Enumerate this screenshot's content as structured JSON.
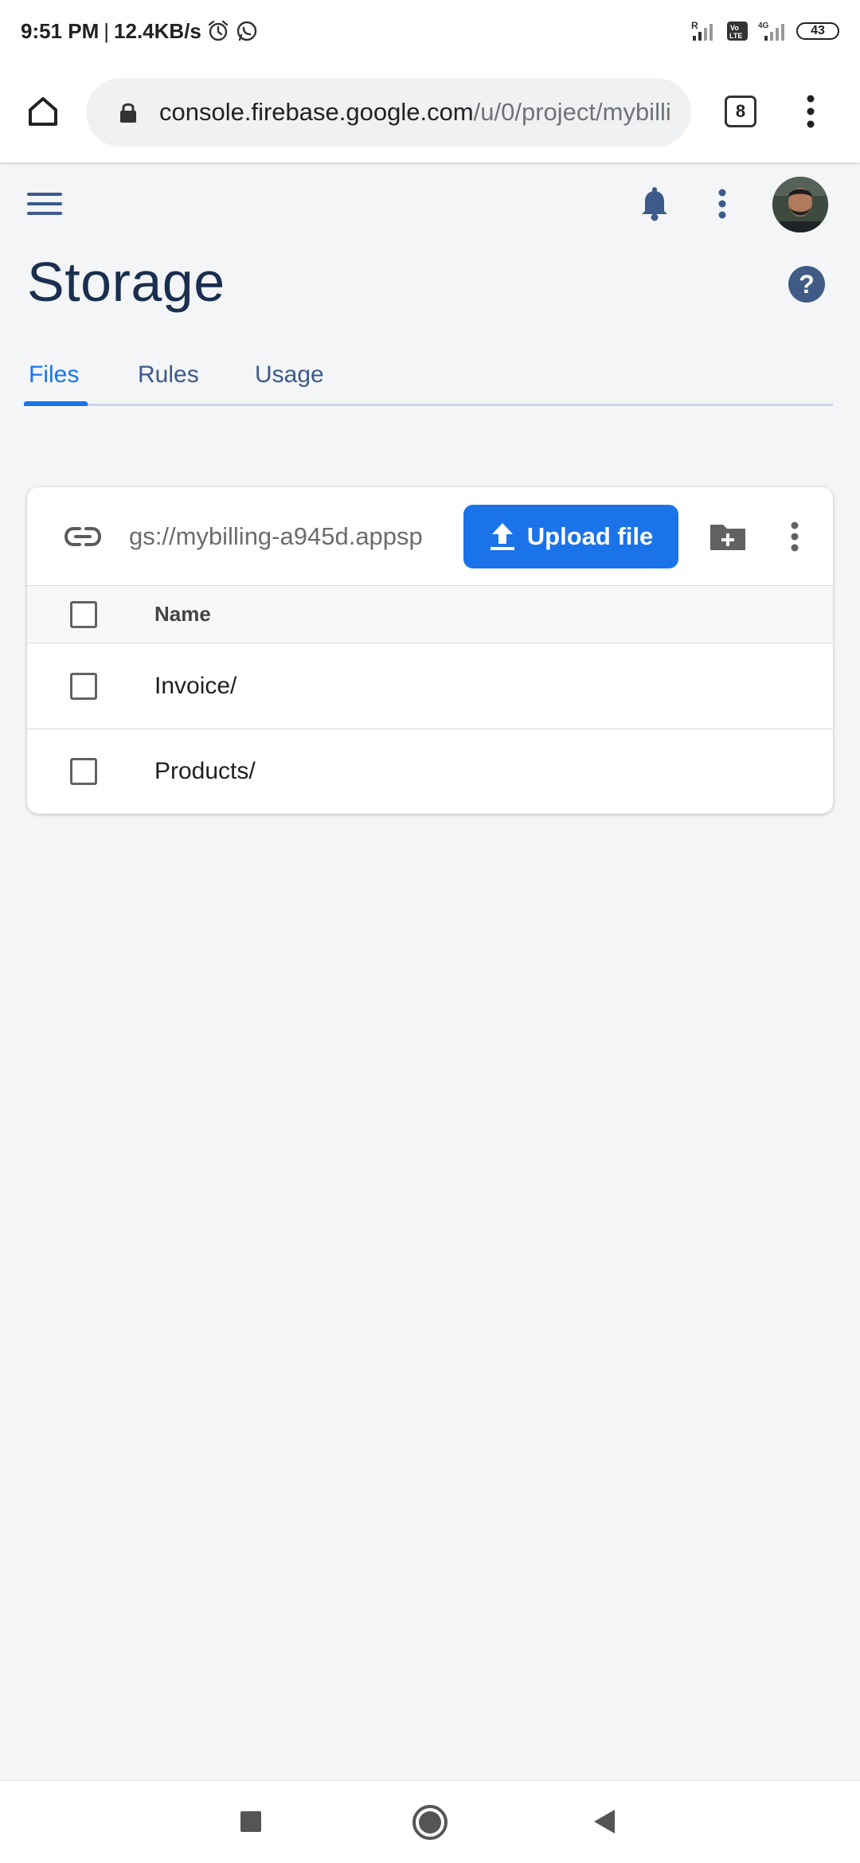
{
  "status_bar": {
    "time": "9:51 PM",
    "separator": "|",
    "speed": "12.4KB/s",
    "battery": "43",
    "icons": [
      "alarm-icon",
      "whatsapp-icon",
      "signal-icon",
      "volte-icon",
      "4g-signal-icon",
      "battery-icon"
    ]
  },
  "browser": {
    "url_domain": "console.firebase.google.com",
    "url_path": "/u/0/project/mybilli",
    "tab_count": "8"
  },
  "header": {
    "title": "Storage",
    "help_label": "?",
    "tabs": [
      {
        "label": "Files",
        "active": true
      },
      {
        "label": "Rules",
        "active": false
      },
      {
        "label": "Usage",
        "active": false
      }
    ]
  },
  "storage": {
    "bucket_path": "gs://mybilling-a945d.appsp",
    "upload_label": "Upload file",
    "column_name": "Name",
    "rows": [
      {
        "name": "Invoice/"
      },
      {
        "name": "Products/"
      }
    ]
  },
  "colors": {
    "accent": "#1a73e8",
    "title": "#1a2f4f",
    "nav_icon": "#3c5a8a",
    "background": "#f4f5f7"
  }
}
